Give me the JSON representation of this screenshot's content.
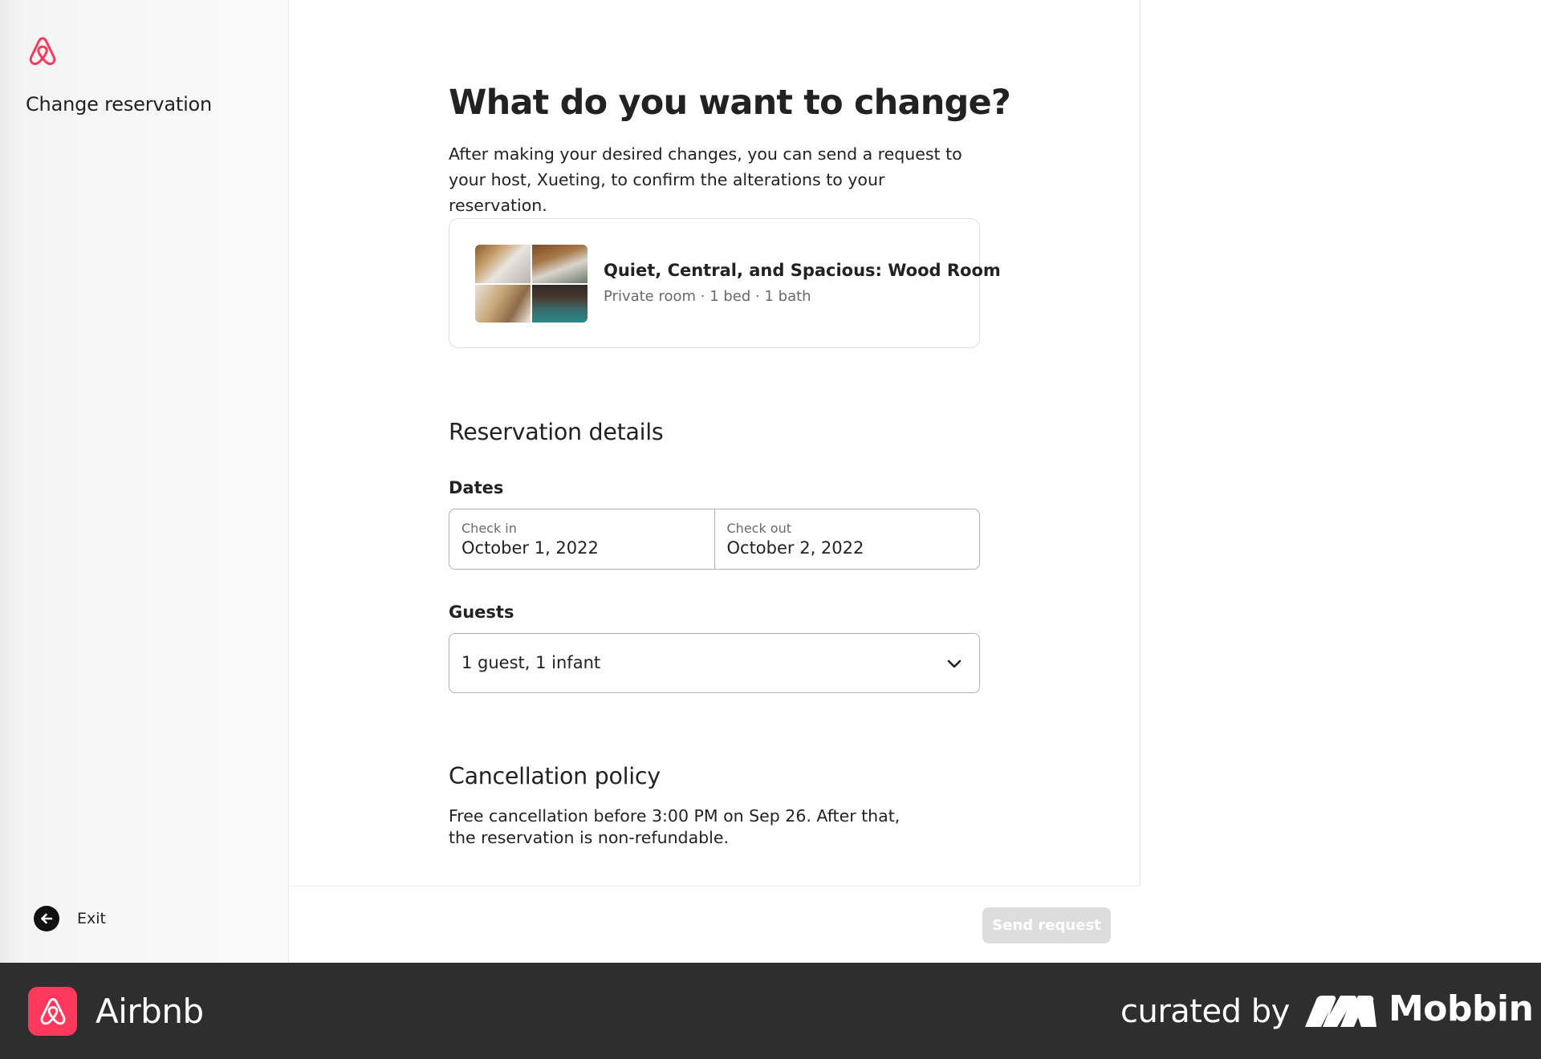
{
  "sidebar": {
    "title": "Change reservation",
    "exit_label": "Exit"
  },
  "main": {
    "title": "What do you want to change?",
    "intro": "After making your desired changes, you can send a request to your host, Xueting, to confirm the alterations to your reservation.",
    "listing": {
      "name": "Quiet, Central, and Spacious: Wood Room",
      "meta": "Private room · 1 bed · 1 bath"
    },
    "reservation_details": {
      "heading": "Reservation details",
      "dates_label": "Dates",
      "check_in_label": "Check in",
      "check_in_value": "October 1, 2022",
      "check_out_label": "Check out",
      "check_out_value": "October 2, 2022",
      "guests_label": "Guests",
      "guests_value": "1 guest, 1 infant"
    },
    "cancellation": {
      "heading": "Cancellation policy",
      "text": "Free cancellation before 3:00 PM on Sep 26. After that, the reservation is non-refundable."
    },
    "send_button_label": "Send request"
  },
  "banner": {
    "app_name": "Airbnb",
    "curated_by": "curated by",
    "curator_name": "Mobbin"
  },
  "colors": {
    "brand": "#ff385c",
    "text": "#222222",
    "muted": "#6a6a6a",
    "disabled_button": "#dddddd",
    "banner_bg": "#2e2e2e"
  },
  "icons": [
    "airbnb-logo-icon",
    "arrow-left-icon",
    "chevron-down-icon",
    "mobbin-logo-icon"
  ]
}
